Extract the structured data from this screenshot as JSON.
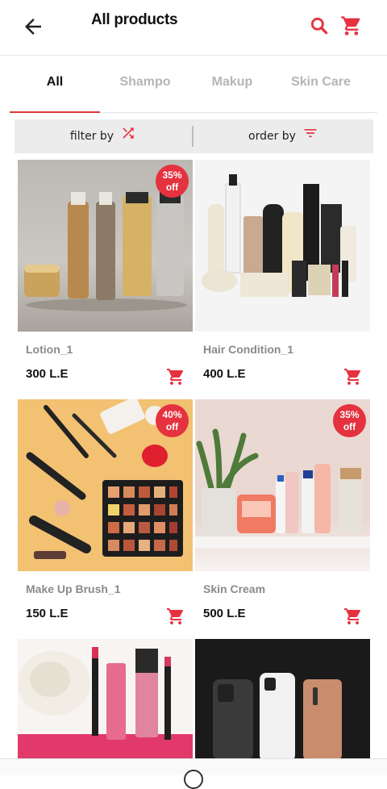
{
  "header": {
    "title": "All products"
  },
  "tabs": [
    {
      "label": "All",
      "active": true
    },
    {
      "label": "Shampo",
      "active": false
    },
    {
      "label": "Makup",
      "active": false
    },
    {
      "label": "Skin Care",
      "active": false
    }
  ],
  "filter": {
    "filter_label": "filter by",
    "order_label": "order by"
  },
  "products": [
    {
      "name": "Lotion_1",
      "price": "300 L.E",
      "discount": "35%",
      "discount_suffix": "off"
    },
    {
      "name": "Hair Condition_1",
      "price": "400 L.E"
    },
    {
      "name": "Make Up Brush_1",
      "price": "150 L.E",
      "discount": "40%",
      "discount_suffix": "off"
    },
    {
      "name": "Skin Cream",
      "price": "500 L.E",
      "discount": "35%",
      "discount_suffix": "off"
    },
    {
      "name": "",
      "price": ""
    },
    {
      "name": "",
      "price": ""
    }
  ],
  "colors": {
    "accent": "#e5323f",
    "tab_underline": "#d93a3a",
    "filter_bg": "#ececec"
  }
}
